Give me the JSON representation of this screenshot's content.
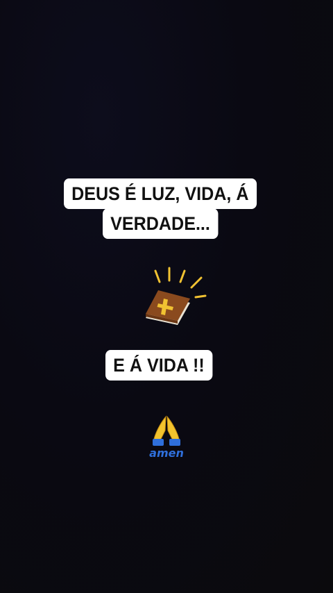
{
  "captions": {
    "line1": "DEUS É LUZ, VIDA, Á",
    "line2": "VERDADE...",
    "line3": "E Á VIDA !!"
  },
  "sticker": {
    "amen_text": "amen"
  },
  "icons": {
    "book": "holy-bible-icon",
    "prayer": "praying-hands-icon"
  },
  "colors": {
    "background": "#0b0a0f",
    "caption_bg": "#ffffff",
    "caption_text": "#111111",
    "book_cover": "#8a4a1e",
    "cross": "#f1c232",
    "amen_blue": "#2f6fdb",
    "hands": "#f2c32e"
  }
}
